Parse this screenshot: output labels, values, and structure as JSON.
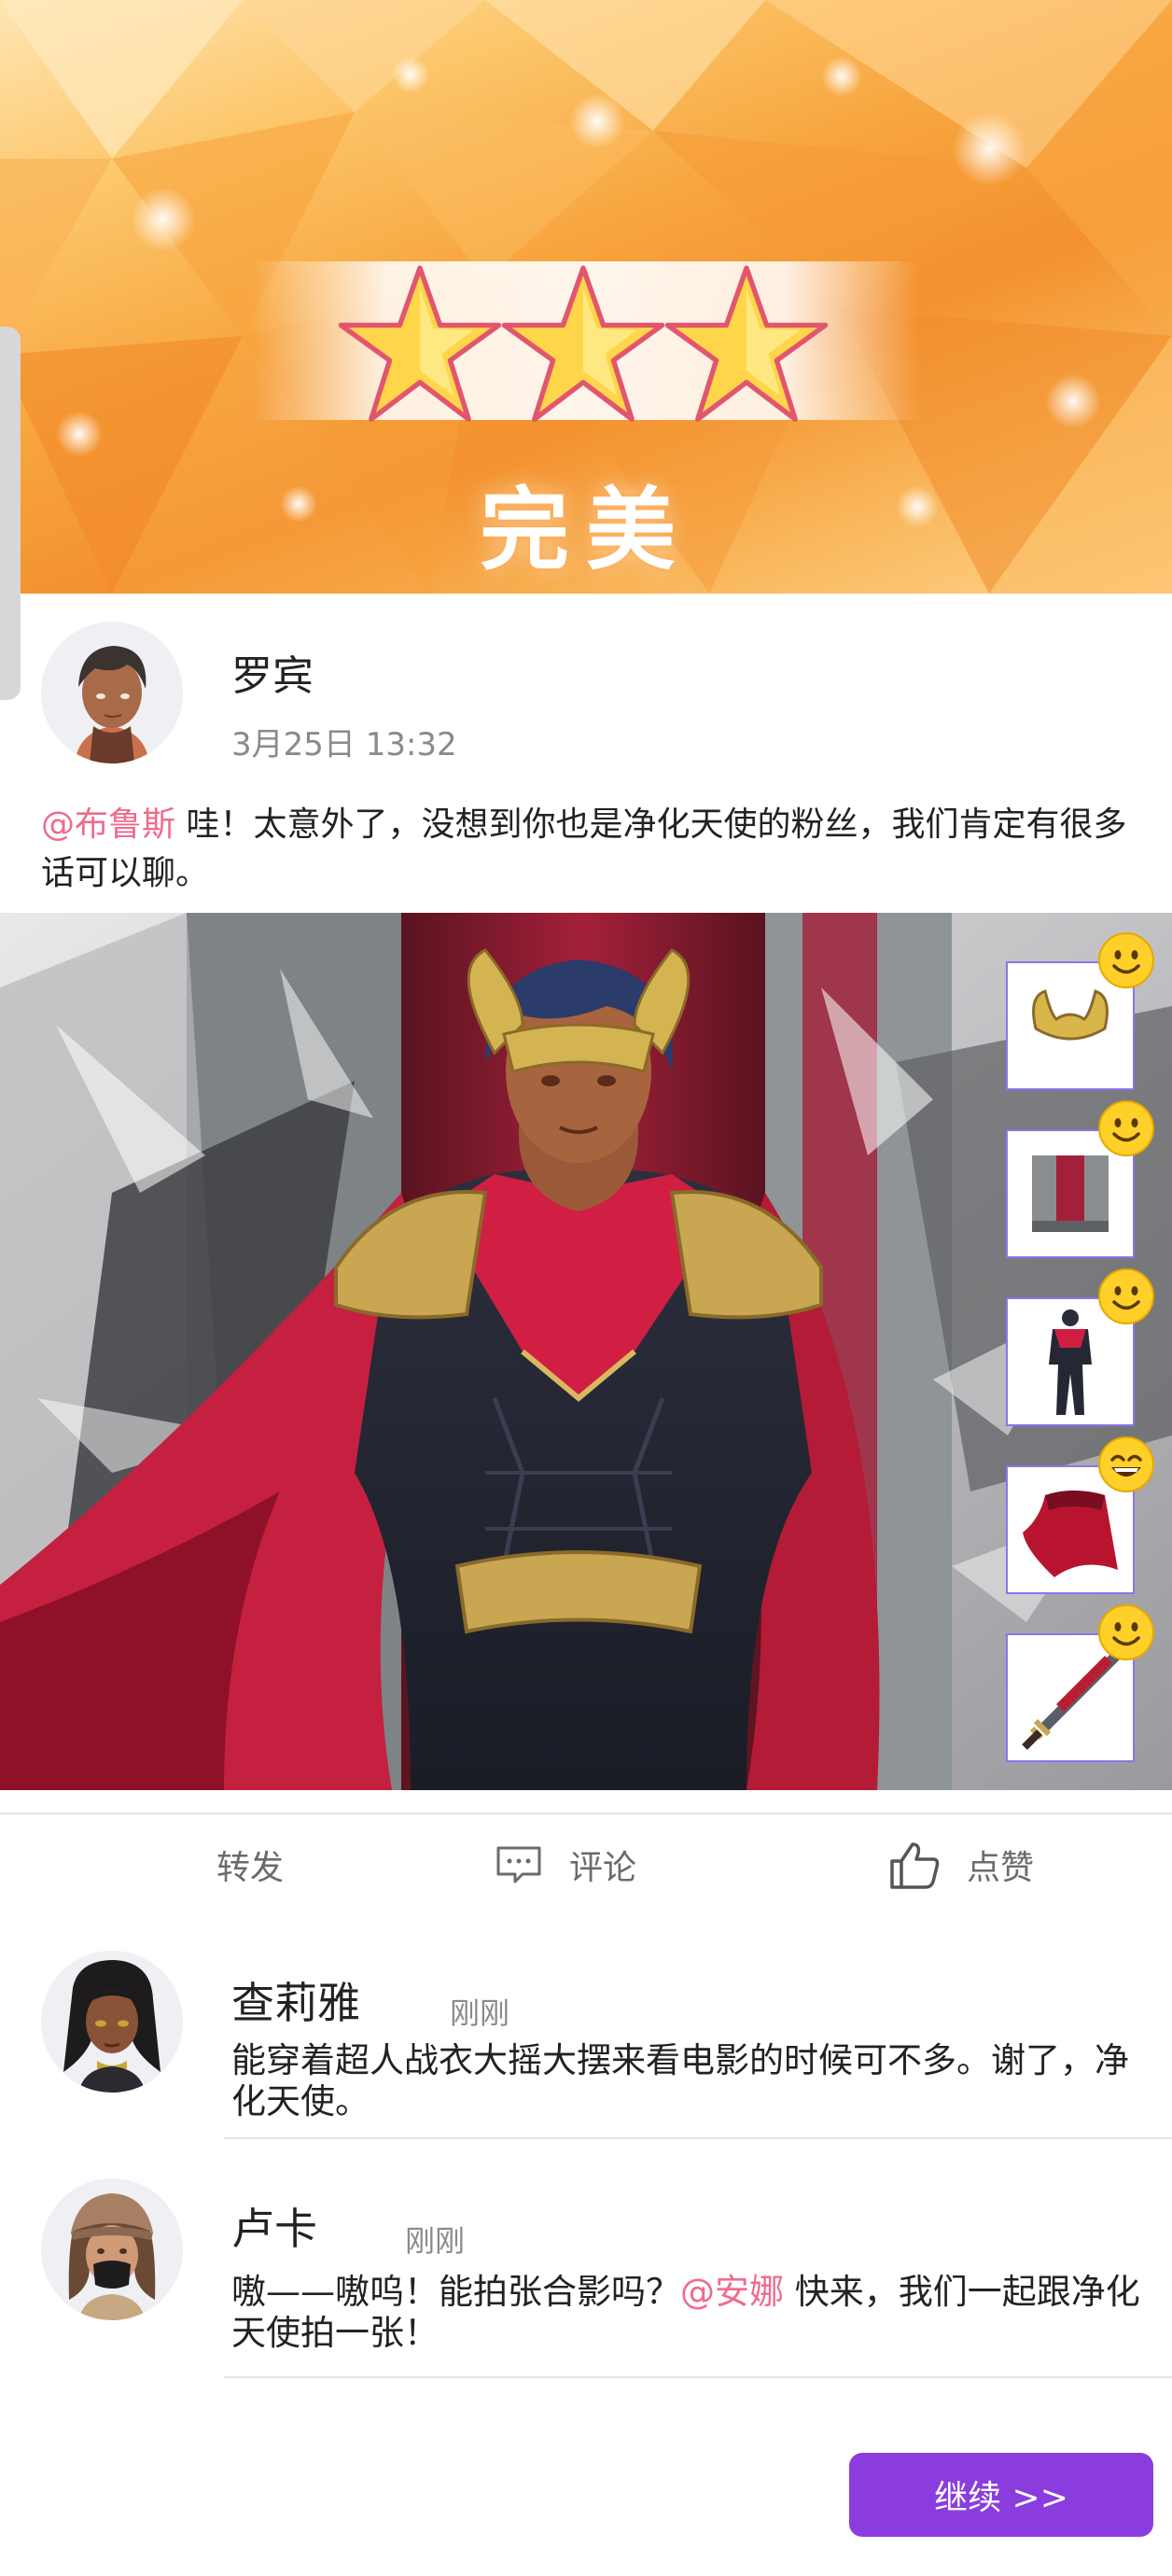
{
  "banner": {
    "star_count": 3,
    "rating_label": "完美"
  },
  "post": {
    "author": "罗宾",
    "date": "3月25日 13:32",
    "mention": "@布鲁斯",
    "text": " 哇！太意外了，没想到你也是净化天使的粉丝，我们肯定有很多话可以聊。",
    "outfit_items": [
      {
        "name": "golden-crown",
        "reaction": "smile"
      },
      {
        "name": "red-hall-background",
        "reaction": "smile"
      },
      {
        "name": "red-black-supersuit",
        "reaction": "smile"
      },
      {
        "name": "red-cape",
        "reaction": "grin"
      },
      {
        "name": "sword",
        "reaction": "smile"
      }
    ]
  },
  "actions": {
    "share": "转发",
    "comment": "评论",
    "like": "点赞"
  },
  "comments": [
    {
      "name": "查莉雅",
      "time": "刚刚",
      "text": "能穿着超人战衣大摇大摆来看电影的时候可不多。谢了，净化天使。"
    },
    {
      "name": "卢卡",
      "time": "刚刚",
      "text_before": "嗷——嗷呜！能拍张合影吗？",
      "mention": "@安娜",
      "text_after": " 快来，我们一起跟净化天使拍一张！"
    }
  ],
  "continue_label": "继续 >>",
  "colors": {
    "accent": "#8a3cdf",
    "mention": "#ef6b8c",
    "slot_border": "#8b76e8"
  }
}
